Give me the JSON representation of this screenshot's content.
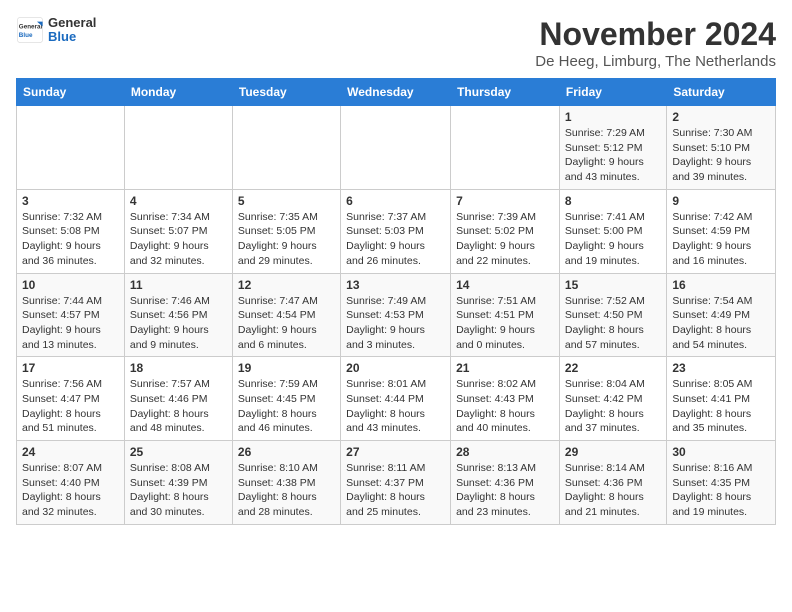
{
  "header": {
    "logo": {
      "general": "General",
      "blue": "Blue"
    },
    "title": "November 2024",
    "location": "De Heeg, Limburg, The Netherlands"
  },
  "calendar": {
    "weekdays": [
      "Sunday",
      "Monday",
      "Tuesday",
      "Wednesday",
      "Thursday",
      "Friday",
      "Saturday"
    ],
    "weeks": [
      [
        {
          "day": "",
          "sunrise": "",
          "sunset": "",
          "daylight": ""
        },
        {
          "day": "",
          "sunrise": "",
          "sunset": "",
          "daylight": ""
        },
        {
          "day": "",
          "sunrise": "",
          "sunset": "",
          "daylight": ""
        },
        {
          "day": "",
          "sunrise": "",
          "sunset": "",
          "daylight": ""
        },
        {
          "day": "",
          "sunrise": "",
          "sunset": "",
          "daylight": ""
        },
        {
          "day": "1",
          "sunrise": "Sunrise: 7:29 AM",
          "sunset": "Sunset: 5:12 PM",
          "daylight": "Daylight: 9 hours and 43 minutes."
        },
        {
          "day": "2",
          "sunrise": "Sunrise: 7:30 AM",
          "sunset": "Sunset: 5:10 PM",
          "daylight": "Daylight: 9 hours and 39 minutes."
        }
      ],
      [
        {
          "day": "3",
          "sunrise": "Sunrise: 7:32 AM",
          "sunset": "Sunset: 5:08 PM",
          "daylight": "Daylight: 9 hours and 36 minutes."
        },
        {
          "day": "4",
          "sunrise": "Sunrise: 7:34 AM",
          "sunset": "Sunset: 5:07 PM",
          "daylight": "Daylight: 9 hours and 32 minutes."
        },
        {
          "day": "5",
          "sunrise": "Sunrise: 7:35 AM",
          "sunset": "Sunset: 5:05 PM",
          "daylight": "Daylight: 9 hours and 29 minutes."
        },
        {
          "day": "6",
          "sunrise": "Sunrise: 7:37 AM",
          "sunset": "Sunset: 5:03 PM",
          "daylight": "Daylight: 9 hours and 26 minutes."
        },
        {
          "day": "7",
          "sunrise": "Sunrise: 7:39 AM",
          "sunset": "Sunset: 5:02 PM",
          "daylight": "Daylight: 9 hours and 22 minutes."
        },
        {
          "day": "8",
          "sunrise": "Sunrise: 7:41 AM",
          "sunset": "Sunset: 5:00 PM",
          "daylight": "Daylight: 9 hours and 19 minutes."
        },
        {
          "day": "9",
          "sunrise": "Sunrise: 7:42 AM",
          "sunset": "Sunset: 4:59 PM",
          "daylight": "Daylight: 9 hours and 16 minutes."
        }
      ],
      [
        {
          "day": "10",
          "sunrise": "Sunrise: 7:44 AM",
          "sunset": "Sunset: 4:57 PM",
          "daylight": "Daylight: 9 hours and 13 minutes."
        },
        {
          "day": "11",
          "sunrise": "Sunrise: 7:46 AM",
          "sunset": "Sunset: 4:56 PM",
          "daylight": "Daylight: 9 hours and 9 minutes."
        },
        {
          "day": "12",
          "sunrise": "Sunrise: 7:47 AM",
          "sunset": "Sunset: 4:54 PM",
          "daylight": "Daylight: 9 hours and 6 minutes."
        },
        {
          "day": "13",
          "sunrise": "Sunrise: 7:49 AM",
          "sunset": "Sunset: 4:53 PM",
          "daylight": "Daylight: 9 hours and 3 minutes."
        },
        {
          "day": "14",
          "sunrise": "Sunrise: 7:51 AM",
          "sunset": "Sunset: 4:51 PM",
          "daylight": "Daylight: 9 hours and 0 minutes."
        },
        {
          "day": "15",
          "sunrise": "Sunrise: 7:52 AM",
          "sunset": "Sunset: 4:50 PM",
          "daylight": "Daylight: 8 hours and 57 minutes."
        },
        {
          "day": "16",
          "sunrise": "Sunrise: 7:54 AM",
          "sunset": "Sunset: 4:49 PM",
          "daylight": "Daylight: 8 hours and 54 minutes."
        }
      ],
      [
        {
          "day": "17",
          "sunrise": "Sunrise: 7:56 AM",
          "sunset": "Sunset: 4:47 PM",
          "daylight": "Daylight: 8 hours and 51 minutes."
        },
        {
          "day": "18",
          "sunrise": "Sunrise: 7:57 AM",
          "sunset": "Sunset: 4:46 PM",
          "daylight": "Daylight: 8 hours and 48 minutes."
        },
        {
          "day": "19",
          "sunrise": "Sunrise: 7:59 AM",
          "sunset": "Sunset: 4:45 PM",
          "daylight": "Daylight: 8 hours and 46 minutes."
        },
        {
          "day": "20",
          "sunrise": "Sunrise: 8:01 AM",
          "sunset": "Sunset: 4:44 PM",
          "daylight": "Daylight: 8 hours and 43 minutes."
        },
        {
          "day": "21",
          "sunrise": "Sunrise: 8:02 AM",
          "sunset": "Sunset: 4:43 PM",
          "daylight": "Daylight: 8 hours and 40 minutes."
        },
        {
          "day": "22",
          "sunrise": "Sunrise: 8:04 AM",
          "sunset": "Sunset: 4:42 PM",
          "daylight": "Daylight: 8 hours and 37 minutes."
        },
        {
          "day": "23",
          "sunrise": "Sunrise: 8:05 AM",
          "sunset": "Sunset: 4:41 PM",
          "daylight": "Daylight: 8 hours and 35 minutes."
        }
      ],
      [
        {
          "day": "24",
          "sunrise": "Sunrise: 8:07 AM",
          "sunset": "Sunset: 4:40 PM",
          "daylight": "Daylight: 8 hours and 32 minutes."
        },
        {
          "day": "25",
          "sunrise": "Sunrise: 8:08 AM",
          "sunset": "Sunset: 4:39 PM",
          "daylight": "Daylight: 8 hours and 30 minutes."
        },
        {
          "day": "26",
          "sunrise": "Sunrise: 8:10 AM",
          "sunset": "Sunset: 4:38 PM",
          "daylight": "Daylight: 8 hours and 28 minutes."
        },
        {
          "day": "27",
          "sunrise": "Sunrise: 8:11 AM",
          "sunset": "Sunset: 4:37 PM",
          "daylight": "Daylight: 8 hours and 25 minutes."
        },
        {
          "day": "28",
          "sunrise": "Sunrise: 8:13 AM",
          "sunset": "Sunset: 4:36 PM",
          "daylight": "Daylight: 8 hours and 23 minutes."
        },
        {
          "day": "29",
          "sunrise": "Sunrise: 8:14 AM",
          "sunset": "Sunset: 4:36 PM",
          "daylight": "Daylight: 8 hours and 21 minutes."
        },
        {
          "day": "30",
          "sunrise": "Sunrise: 8:16 AM",
          "sunset": "Sunset: 4:35 PM",
          "daylight": "Daylight: 8 hours and 19 minutes."
        }
      ]
    ]
  }
}
